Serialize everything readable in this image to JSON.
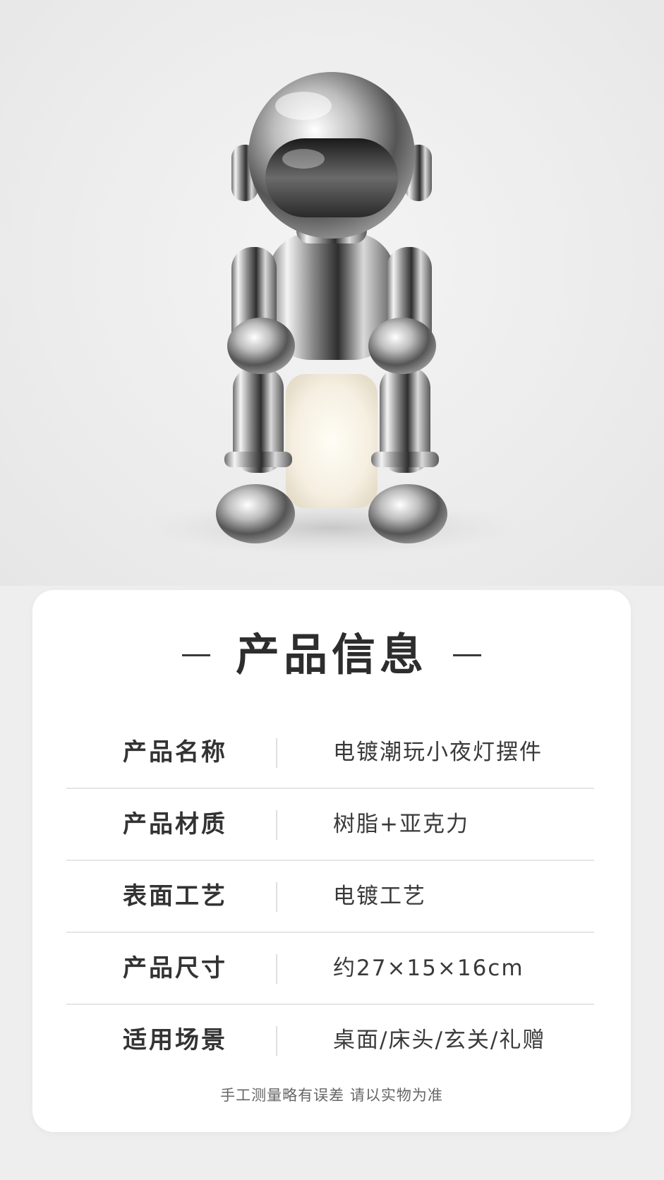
{
  "hero": {
    "product_image": "chrome-astronaut-night-light"
  },
  "info_card": {
    "title": "产品信息",
    "rows": [
      {
        "label": "产品名称",
        "value": "电镀潮玩小夜灯摆件"
      },
      {
        "label": "产品材质",
        "value": "树脂+亚克力"
      },
      {
        "label": "表面工艺",
        "value": "电镀工艺"
      },
      {
        "label": "产品尺寸",
        "value": "约27×15×16cm"
      },
      {
        "label": "适用场景",
        "value": "桌面/床头/玄关/礼赠"
      }
    ],
    "footnote": "手工测量略有误差  请以实物为准"
  },
  "colors": {
    "background": "#eeeeee",
    "card": "#ffffff",
    "title_text": "#2d2d2d",
    "divider": "#e6e6e6"
  }
}
